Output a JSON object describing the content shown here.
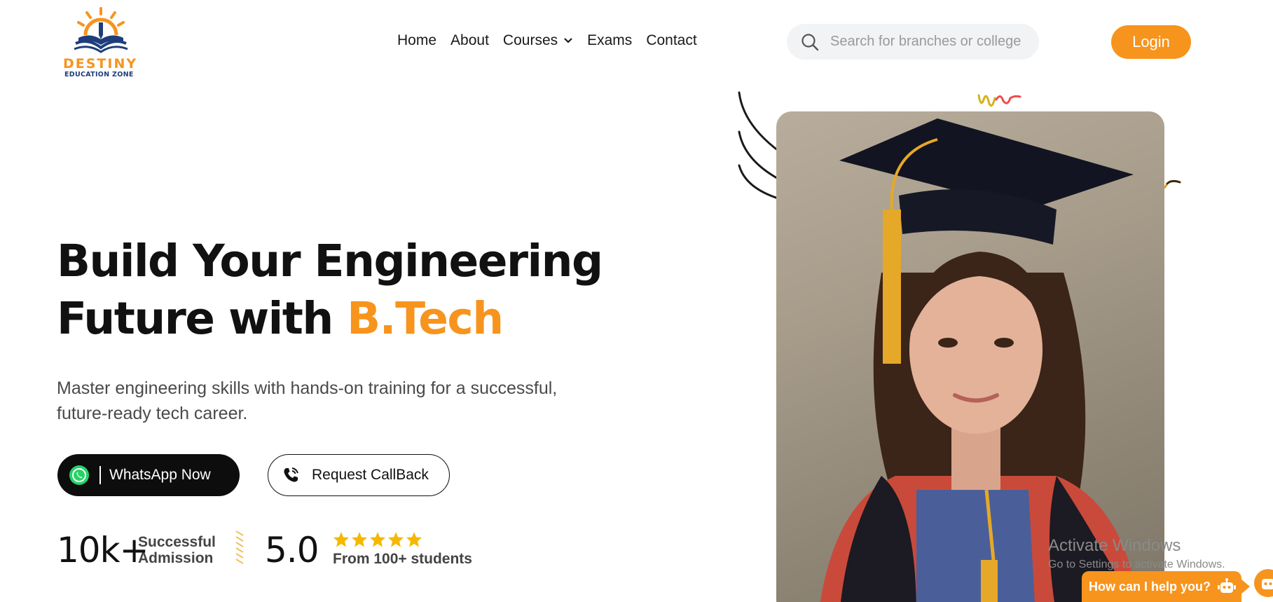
{
  "brand": {
    "name": "DESTINY",
    "tagline": "EDUCATION ZONE"
  },
  "nav": {
    "items": [
      {
        "label": "Home"
      },
      {
        "label": "About"
      },
      {
        "label": "Courses"
      },
      {
        "label": "Exams"
      },
      {
        "label": "Contact"
      }
    ]
  },
  "search": {
    "placeholder": "Search for branches or college",
    "value": ""
  },
  "header": {
    "login_label": "Login"
  },
  "hero": {
    "title_line1": "Build Your Engineering",
    "title_line2_prefix": "Future with ",
    "title_line2_accent": "B.Tech",
    "description_line1": "Master engineering skills with hands-on training for a successful,",
    "description_line2": "future-ready tech career.",
    "whatsapp_label": "WhatsApp Now",
    "callback_label": "Request CallBack"
  },
  "stats": {
    "admissions_value": "10k+",
    "admissions_label_line1": "Successful",
    "admissions_label_line2": "Admission",
    "rating_value": "5.0",
    "rating_stars": 5,
    "rating_caption": "From 100+ students"
  },
  "overlay": {
    "watermark_title": "Activate Windows",
    "watermark_subtitle": "Go to Settings to activate Windows.",
    "help_label": "How can I help you?"
  },
  "colors": {
    "accent": "#f7941d",
    "dark": "#0d0d0d",
    "whatsapp_green": "#25d366",
    "star": "#f5b800"
  },
  "icons": {
    "search": "search-icon",
    "chevron": "chevron-down-icon",
    "whatsapp": "whatsapp-icon",
    "phone": "phone-icon",
    "star": "star-icon",
    "bot": "robot-icon"
  }
}
